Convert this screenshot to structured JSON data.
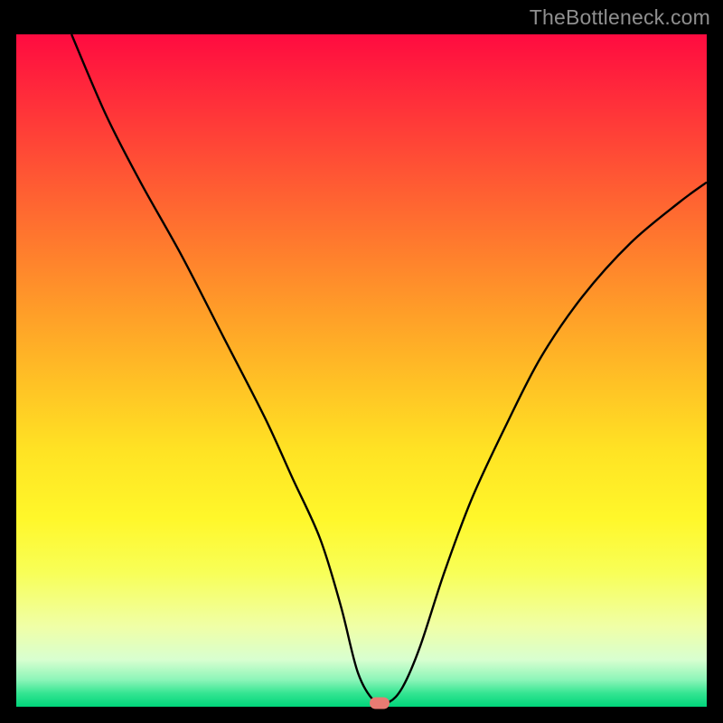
{
  "watermark": "TheBottleneck.com",
  "marker": {
    "x_pct": 52.6,
    "y_pct": 99.5
  },
  "chart_data": {
    "type": "line",
    "title": "",
    "xlabel": "",
    "ylabel": "",
    "xlim": [
      0,
      100
    ],
    "ylim": [
      0,
      100
    ],
    "legend": false,
    "grid": false,
    "annotations": [
      "TheBottleneck.com"
    ],
    "series": [
      {
        "name": "bottleneck-curve",
        "x": [
          8,
          13,
          18,
          24,
          30,
          36,
          40,
          44,
          47,
          49.5,
          52,
          54,
          56,
          58.5,
          62,
          66,
          71,
          76,
          82,
          89,
          96,
          100
        ],
        "y": [
          100,
          88,
          78,
          67,
          55,
          43,
          34,
          25,
          15,
          5,
          0.7,
          0.7,
          3,
          9,
          20,
          31,
          42,
          52,
          61,
          69,
          75,
          78
        ]
      }
    ],
    "background_gradient": {
      "direction": "top-to-bottom",
      "stops": [
        {
          "pos": 0.0,
          "color": "#ff0b40"
        },
        {
          "pos": 0.5,
          "color": "#ffd424"
        },
        {
          "pos": 0.85,
          "color": "#f5ff8a"
        },
        {
          "pos": 1.0,
          "color": "#00d47a"
        }
      ]
    },
    "marker": {
      "x": 52.6,
      "y": 0.5,
      "color": "#e87b73",
      "shape": "pill"
    }
  }
}
